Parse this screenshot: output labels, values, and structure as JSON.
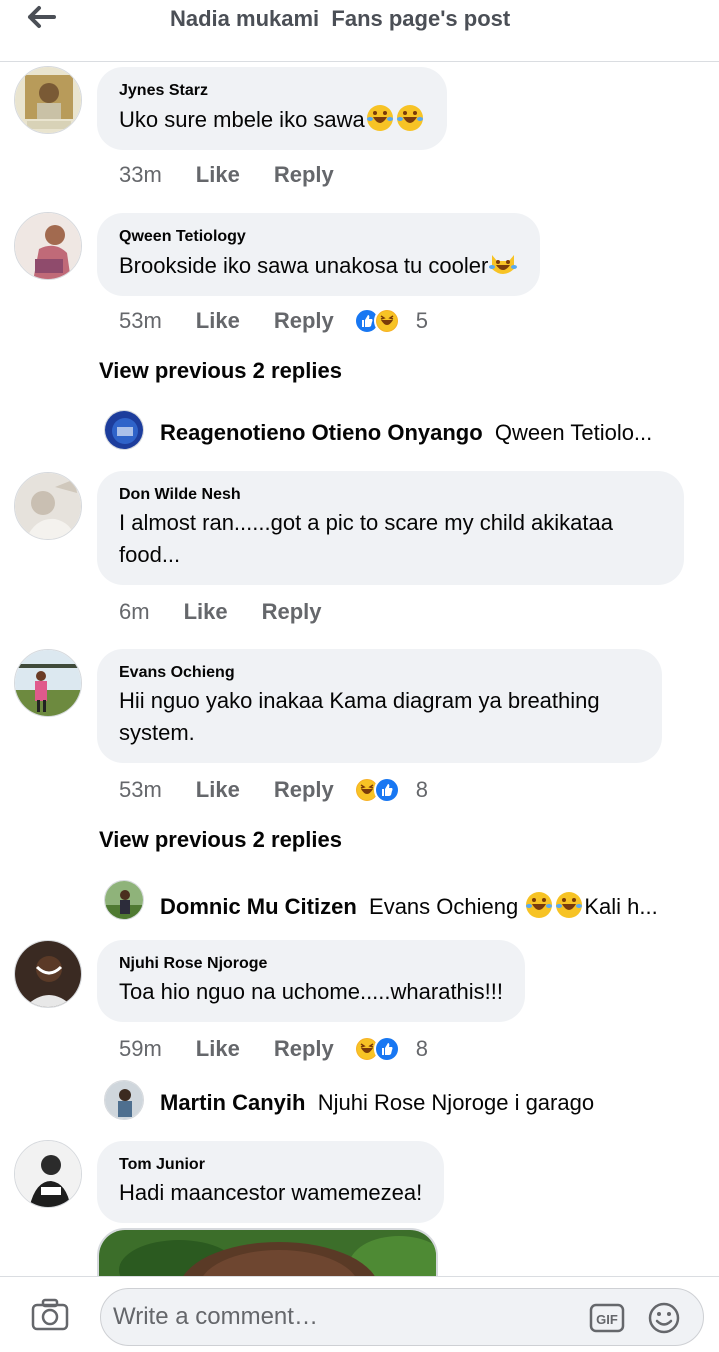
{
  "header": {
    "title": "Nadia mukami  Fans page's post"
  },
  "comments": [
    {
      "author": "Jynes Starz",
      "text": "Uko sure mbele iko sawa",
      "time": "33m",
      "like": "Like",
      "reply": "Reply"
    },
    {
      "author": "Qween Tetiology",
      "text": "Brookside iko sawa unakosa tu cooler",
      "time": "53m",
      "like": "Like",
      "reply": "Reply",
      "reactions": "5"
    },
    {
      "author": "Don Wilde Nesh",
      "text": "I almost ran......got a pic to scare my child akikataa food...",
      "time": "6m",
      "like": "Like",
      "reply": "Reply"
    },
    {
      "author": "Evans Ochieng",
      "text": "Hii nguo yako inakaa Kama diagram ya breathing system.",
      "time": "53m",
      "like": "Like",
      "reply": "Reply",
      "reactions": "8"
    },
    {
      "author": "Njuhi Rose Njoroge",
      "text": "Toa hio nguo na uchome.....wharathis!!!",
      "time": "59m",
      "like": "Like",
      "reply": "Reply",
      "reactions": "8"
    },
    {
      "author": "Tom Junior",
      "text": "Hadi maancestor wamemezea!"
    }
  ],
  "view_previous": [
    "View previous 2 replies",
    "View previous 2 replies"
  ],
  "replies": [
    {
      "author": "Reagenotieno Otieno Onyango",
      "text": "Qween Tetiolo..."
    },
    {
      "author": "Domnic Mu Citizen",
      "text": "Evans Ochieng",
      "text2": "Kali h..."
    },
    {
      "author": "Martin Canyih",
      "text": "Njuhi Rose Njoroge i garago"
    }
  ],
  "composer": {
    "placeholder": "Write a comment…"
  },
  "icons": [
    "back-arrow-icon",
    "camera-icon",
    "gif-icon",
    "smiley-icon",
    "like-reaction-icon",
    "haha-reaction-icon",
    "laughing-emoji-icon"
  ],
  "colors": {
    "accent": "#1877f2",
    "bubble": "#f0f2f5",
    "meta": "#65676b"
  }
}
